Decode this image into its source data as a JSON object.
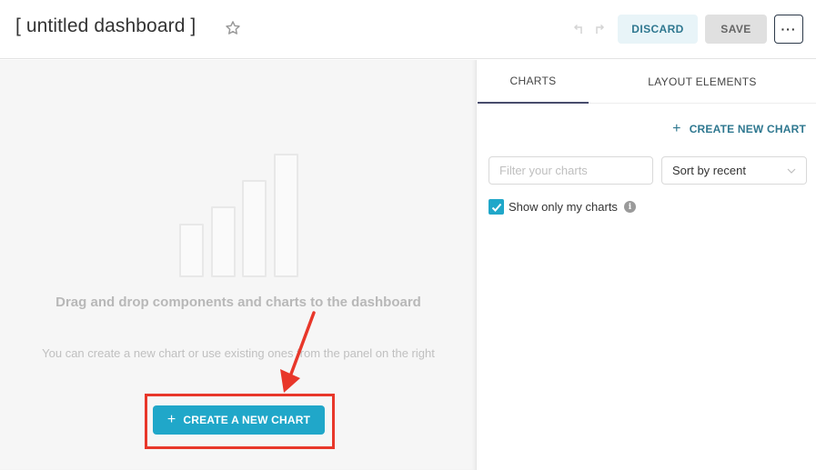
{
  "header": {
    "title": "[ untitled dashboard ]",
    "star_icon": "star-outline-icon",
    "undo_icon": "undo-icon",
    "redo_icon": "redo-icon",
    "discard_label": "DISCARD",
    "save_label": "SAVE",
    "more_label": "···"
  },
  "canvas": {
    "placeholder_icon": "bar-chart-placeholder-icon",
    "empty_title": "Drag and drop components and charts to the dashboard",
    "empty_subtitle": "You can create a new chart or use existing ones from the panel on the right",
    "cta_icon": "+",
    "cta_label": "CREATE A NEW CHART",
    "annotation": {
      "type": "red-box-with-arrow",
      "target": "create-a-new-chart-button",
      "color": "#e8372a"
    }
  },
  "panel": {
    "tabs": [
      {
        "label": "CHARTS",
        "active": true
      },
      {
        "label": "LAYOUT ELEMENTS",
        "active": false
      }
    ],
    "create_link_icon": "+",
    "create_link_label": "CREATE NEW CHART",
    "filter": {
      "value": "",
      "placeholder": "Filter your charts"
    },
    "sort": {
      "selected": "Sort by recent"
    },
    "show_only_mine": {
      "label": "Show only my charts",
      "checked": true,
      "info_icon": "i"
    }
  },
  "colors": {
    "accent": "#20a7c9",
    "link": "#2f7890",
    "discard_bg": "#e8f4f8",
    "save_bg": "#e0e0e0",
    "active_tab_underline": "#484c6c",
    "annotation_red": "#e8372a"
  }
}
